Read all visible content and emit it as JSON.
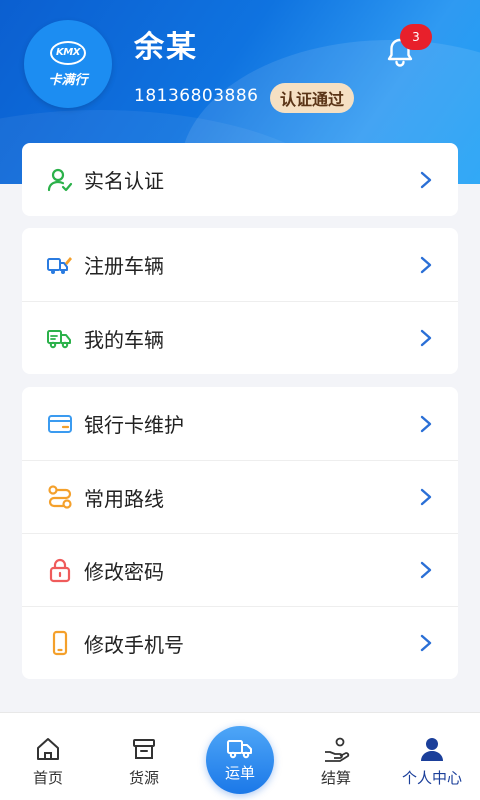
{
  "header": {
    "logo_mark": "KMX",
    "logo_text": "卡满行",
    "user_name": "余某",
    "phone": "18136803886",
    "cert_status": "认证通过",
    "notification_count": "3"
  },
  "menu": {
    "group1": [
      {
        "label": "实名认证",
        "icon": "user-check-icon"
      }
    ],
    "group2": [
      {
        "label": "注册车辆",
        "icon": "truck-edit-icon"
      },
      {
        "label": "我的车辆",
        "icon": "truck-icon"
      }
    ],
    "group3": [
      {
        "label": "银行卡维护",
        "icon": "bank-card-icon"
      },
      {
        "label": "常用路线",
        "icon": "route-icon"
      },
      {
        "label": "修改密码",
        "icon": "lock-icon"
      },
      {
        "label": "修改手机号",
        "icon": "phone-icon"
      }
    ]
  },
  "tabbar": {
    "home": "首页",
    "goods": "货源",
    "waybill": "运单",
    "settle": "结算",
    "profile": "个人中心"
  },
  "colors": {
    "primary_blue": "#1b78e8",
    "badge_red": "#e8202b",
    "cert_bg": "#f5e0c3",
    "active_tab": "#1b3f9a"
  }
}
